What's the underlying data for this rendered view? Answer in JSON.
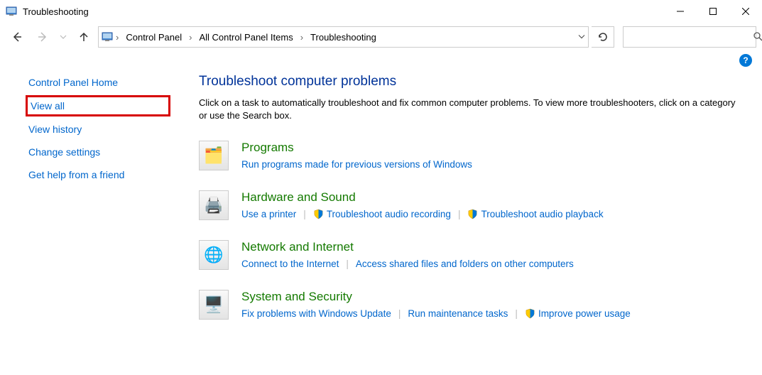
{
  "window": {
    "title": "Troubleshooting"
  },
  "breadcrumb": {
    "items": [
      "Control Panel",
      "All Control Panel Items",
      "Troubleshooting"
    ]
  },
  "sidebar": {
    "items": [
      {
        "label": "Control Panel Home",
        "highlighted": false
      },
      {
        "label": "View all",
        "highlighted": true
      },
      {
        "label": "View history",
        "highlighted": false
      },
      {
        "label": "Change settings",
        "highlighted": false
      },
      {
        "label": "Get help from a friend",
        "highlighted": false
      }
    ]
  },
  "main": {
    "title": "Troubleshoot computer problems",
    "description": "Click on a task to automatically troubleshoot and fix common computer problems. To view more troubleshooters, click on a category or use the Search box.",
    "categories": [
      {
        "title": "Programs",
        "icon": "programs-icon",
        "tasks": [
          {
            "label": "Run programs made for previous versions of Windows",
            "shield": false
          }
        ]
      },
      {
        "title": "Hardware and Sound",
        "icon": "hardware-icon",
        "tasks": [
          {
            "label": "Use a printer",
            "shield": false
          },
          {
            "label": "Troubleshoot audio recording",
            "shield": true
          },
          {
            "label": "Troubleshoot audio playback",
            "shield": true
          }
        ]
      },
      {
        "title": "Network and Internet",
        "icon": "network-icon",
        "tasks": [
          {
            "label": "Connect to the Internet",
            "shield": false
          },
          {
            "label": "Access shared files and folders on other computers",
            "shield": false
          }
        ]
      },
      {
        "title": "System and Security",
        "icon": "system-icon",
        "tasks": [
          {
            "label": "Fix problems with Windows Update",
            "shield": false
          },
          {
            "label": "Run maintenance tasks",
            "shield": false
          },
          {
            "label": "Improve power usage",
            "shield": true
          }
        ]
      }
    ]
  }
}
